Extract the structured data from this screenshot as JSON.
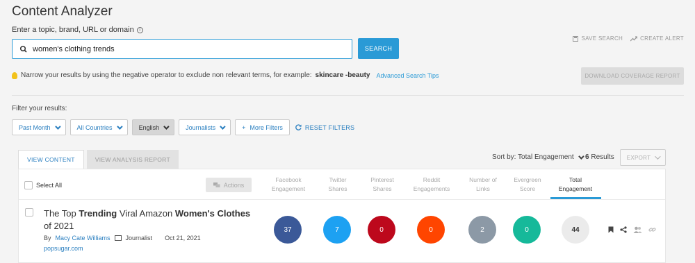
{
  "app_title": "Content Analyzer",
  "search": {
    "label": "Enter a topic, brand, URL or domain",
    "info_icon": "i",
    "value": "women's clothing trends",
    "button": "SEARCH"
  },
  "top_actions": {
    "save": "SAVE SEARCH",
    "alert": "CREATE ALERT"
  },
  "tip": {
    "text": "Narrow your results by using the negative operator to exclude non relevant terms, for example:",
    "example": "skincare -beauty",
    "link": "Advanced Search Tips"
  },
  "download_button": "DOWNLOAD COVERAGE REPORT",
  "filters": {
    "label": "Filter your results:",
    "items": [
      "Past Month",
      "All Countries",
      "English",
      "Journalists",
      "More Filters"
    ],
    "more_prefix": "+",
    "reset": "RESET FILTERS"
  },
  "tabs": [
    "VIEW CONTENT",
    "VIEW ANALYSIS REPORT"
  ],
  "sort": {
    "label": "Sort by: Total Engagement",
    "count": "6",
    "count_label": "Results"
  },
  "export": "EXPORT",
  "table": {
    "select_all": "Select All",
    "actions": "Actions",
    "columns": [
      [
        "Facebook",
        "Engagement"
      ],
      [
        "Twitter",
        "Shares"
      ],
      [
        "Pinterest",
        "Shares"
      ],
      [
        "Reddit",
        "Engagements"
      ],
      [
        "Number of",
        "Links"
      ],
      [
        "Evergreen",
        "Score"
      ],
      [
        "Total",
        "Engagement"
      ]
    ]
  },
  "article": {
    "title_parts": [
      {
        "text": "The Top ",
        "bold": false
      },
      {
        "text": "Trending",
        "bold": true
      },
      {
        "text": " Viral Amazon ",
        "bold": false
      },
      {
        "text": "Women's Clothes",
        "bold": true
      },
      {
        "text": " of 2021",
        "bold": false
      }
    ],
    "by": "By",
    "author": "Macy Cate Williams",
    "role": "Journalist",
    "date": "Oct 21, 2021",
    "domain": "popsugar.com",
    "metrics": [
      {
        "value": "37",
        "color": "#3b5998"
      },
      {
        "value": "7",
        "color": "#1da1f2"
      },
      {
        "value": "0",
        "color": "#bd081c"
      },
      {
        "value": "0",
        "color": "#ff4500"
      },
      {
        "value": "2",
        "color": "#8c99a6"
      },
      {
        "value": "0",
        "color": "#16b99a"
      },
      {
        "value": "44",
        "color": "#ebebeb"
      }
    ]
  },
  "colors": {
    "accent": "#2a9ad6",
    "link": "#2a7fc0"
  }
}
